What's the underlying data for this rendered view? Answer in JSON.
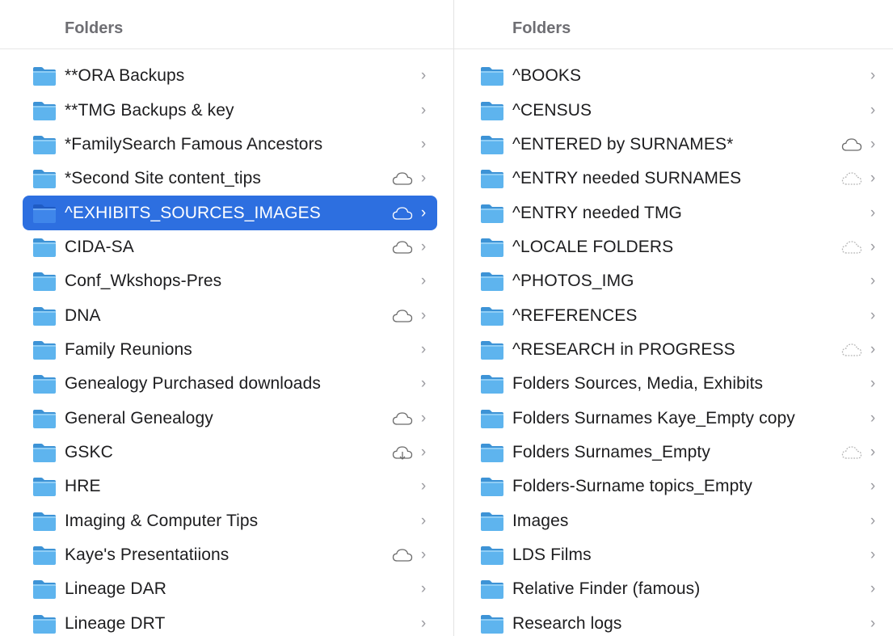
{
  "left": {
    "header": "Folders",
    "items": [
      {
        "label": "**ORA Backups",
        "cloud": "none"
      },
      {
        "label": "**TMG Backups & key",
        "cloud": "none"
      },
      {
        "label": "*FamilySearch Famous Ancestors",
        "cloud": "none"
      },
      {
        "label": "*Second Site content_tips",
        "cloud": "cloud"
      },
      {
        "label": "^EXHIBITS_SOURCES_IMAGES",
        "cloud": "cloud",
        "selected": true
      },
      {
        "label": "CIDA-SA",
        "cloud": "cloud"
      },
      {
        "label": "Conf_Wkshops-Pres",
        "cloud": "none"
      },
      {
        "label": "DNA",
        "cloud": "cloud"
      },
      {
        "label": "Family Reunions",
        "cloud": "none"
      },
      {
        "label": "Genealogy Purchased downloads",
        "cloud": "none"
      },
      {
        "label": "General Genealogy",
        "cloud": "cloud"
      },
      {
        "label": "GSKC",
        "cloud": "cloud-download"
      },
      {
        "label": "HRE",
        "cloud": "none"
      },
      {
        "label": "Imaging & Computer Tips",
        "cloud": "none"
      },
      {
        "label": "Kaye's Presentatiions",
        "cloud": "cloud"
      },
      {
        "label": "Lineage DAR",
        "cloud": "none"
      },
      {
        "label": "Lineage DRT",
        "cloud": "none"
      }
    ]
  },
  "right": {
    "header": "Folders",
    "items": [
      {
        "label": "^BOOKS",
        "cloud": "none"
      },
      {
        "label": "^CENSUS",
        "cloud": "none"
      },
      {
        "label": "^ENTERED by SURNAMES*",
        "cloud": "cloud"
      },
      {
        "label": "^ENTRY needed SURNAMES",
        "cloud": "cloud-dashed"
      },
      {
        "label": "^ENTRY needed TMG",
        "cloud": "none"
      },
      {
        "label": "^LOCALE FOLDERS",
        "cloud": "cloud-dashed"
      },
      {
        "label": "^PHOTOS_IMG",
        "cloud": "none"
      },
      {
        "label": "^REFERENCES",
        "cloud": "none"
      },
      {
        "label": "^RESEARCH in PROGRESS",
        "cloud": "cloud-dashed"
      },
      {
        "label": "Folders Sources, Media, Exhibits",
        "cloud": "none"
      },
      {
        "label": "Folders Surnames Kaye_Empty copy",
        "cloud": "none"
      },
      {
        "label": "Folders Surnames_Empty",
        "cloud": "cloud-dashed"
      },
      {
        "label": "Folders-Surname topics_Empty",
        "cloud": "none"
      },
      {
        "label": "Images",
        "cloud": "none"
      },
      {
        "label": "LDS Films",
        "cloud": "none"
      },
      {
        "label": "Relative Finder (famous)",
        "cloud": "none"
      },
      {
        "label": "Research logs",
        "cloud": "none"
      }
    ]
  },
  "chevron_glyph": "›",
  "colors": {
    "selection": "#2d6fe0",
    "folder_body": "#5eb4ee",
    "folder_tab": "#3d93d6",
    "header_text": "#6e6e73"
  }
}
